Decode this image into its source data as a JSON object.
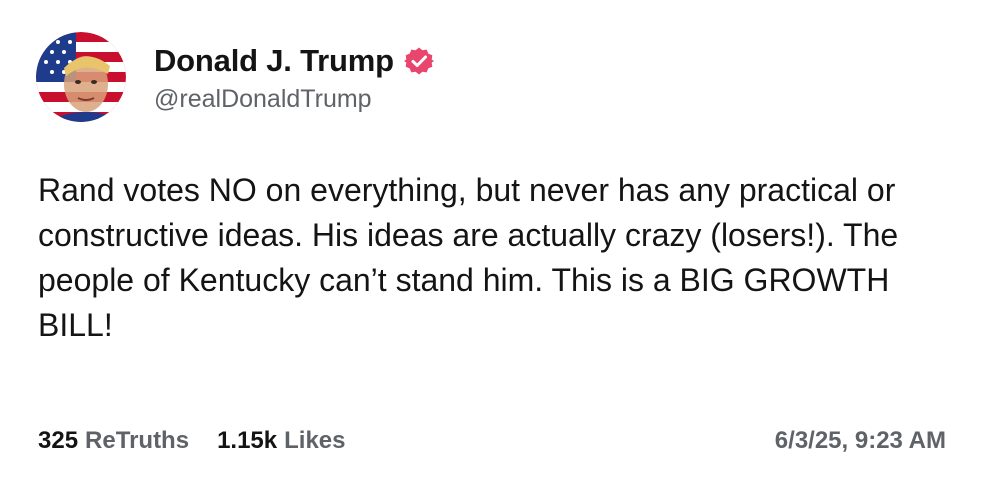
{
  "author": {
    "display_name": "Donald J. Trump",
    "handle": "@realDonaldTrump",
    "verified": true,
    "avatar_icon": "profile-portrait",
    "verified_icon": "verified-badge-icon",
    "verified_color": "#e8466d"
  },
  "post": {
    "text": "Rand votes NO on everything, but never has any practical or constructive ideas. His ideas are actually crazy (losers!). The people of Kentucky can’t stand him. This is a BIG GROWTH BILL!",
    "retruths_count": "325",
    "retruths_label": "ReTruths",
    "likes_count": "1.15k",
    "likes_label": "Likes",
    "timestamp": "6/3/25, 9:23 AM"
  }
}
